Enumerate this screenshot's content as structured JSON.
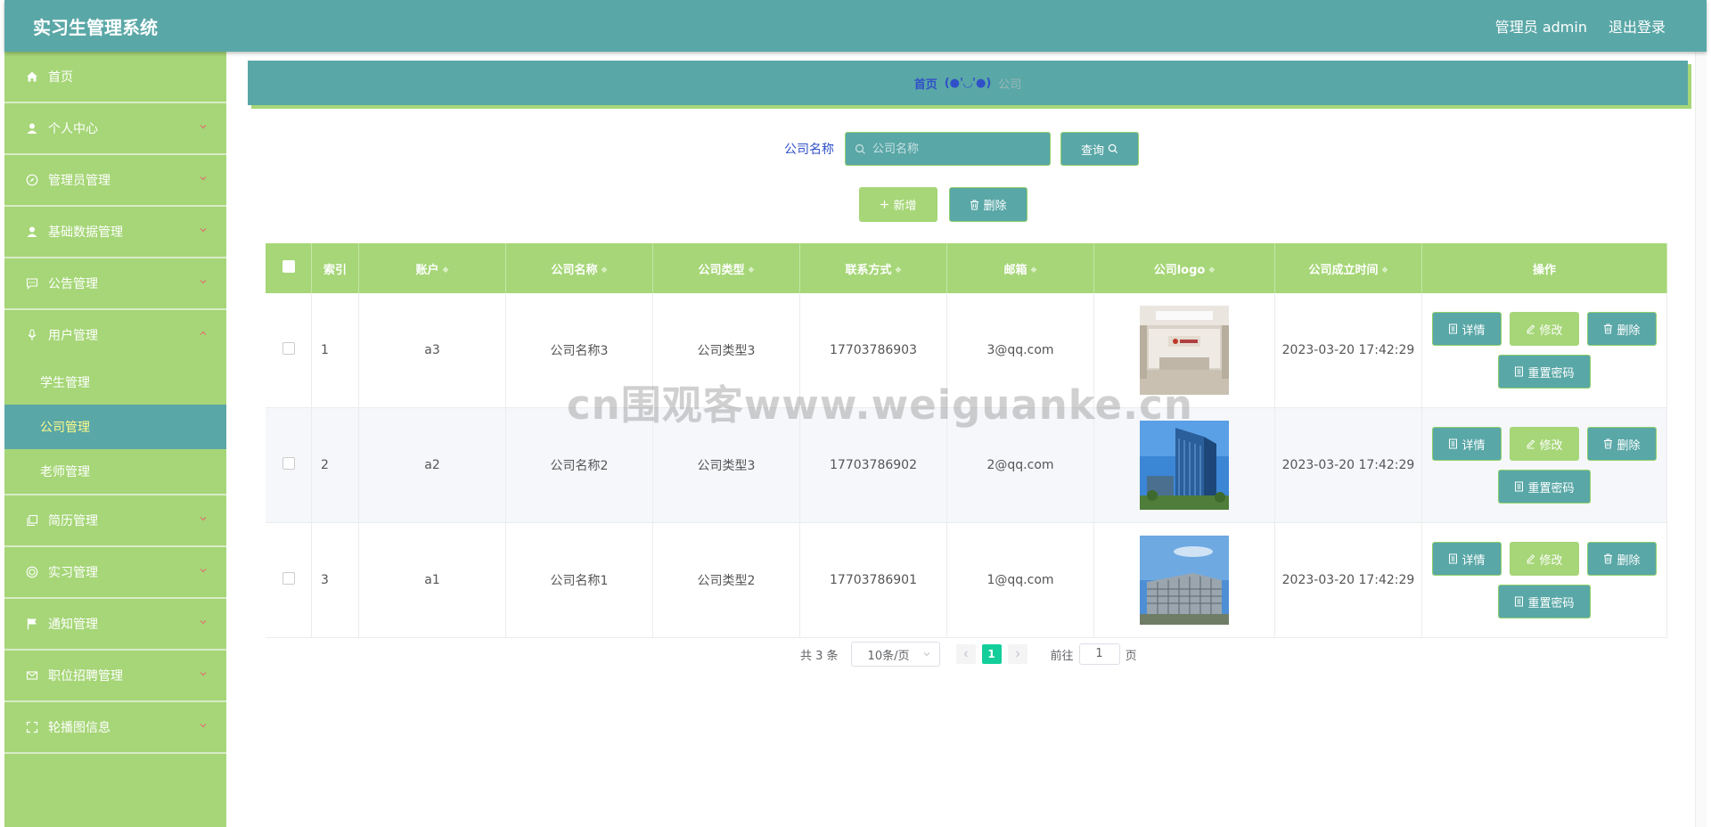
{
  "header": {
    "title": "实习生管理系统",
    "user": "管理员 admin",
    "logout": "退出登录"
  },
  "sidebar": {
    "items": [
      {
        "label": "首页",
        "icon": "home-icon"
      },
      {
        "label": "个人中心",
        "icon": "user-icon"
      },
      {
        "label": "管理员管理",
        "icon": "compass-icon"
      },
      {
        "label": "基础数据管理",
        "icon": "user-icon"
      },
      {
        "label": "公告管理",
        "icon": "chat-icon"
      },
      {
        "label": "用户管理",
        "icon": "mic-icon",
        "children": [
          "学生管理",
          "公司管理",
          "老师管理"
        ]
      },
      {
        "label": "简历管理",
        "icon": "copy-icon"
      },
      {
        "label": "实习管理",
        "icon": "target-icon"
      },
      {
        "label": "通知管理",
        "icon": "flag-icon"
      },
      {
        "label": "职位招聘管理",
        "icon": "mail-icon"
      },
      {
        "label": "轮播图信息",
        "icon": "fullscreen-icon"
      }
    ]
  },
  "breadcrumb": {
    "home": "首页",
    "emoticon": "(●'◡'●)",
    "current": "公司"
  },
  "search": {
    "label": "公司名称",
    "placeholder": "公司名称",
    "query_button": "查询"
  },
  "actions": {
    "add": "新增",
    "delete": "删除"
  },
  "table": {
    "headers": [
      "索引",
      "账户",
      "公司名称",
      "公司类型",
      "联系方式",
      "邮箱",
      "公司logo",
      "公司成立时间",
      "操作"
    ],
    "rows": [
      {
        "index": "1",
        "account": "a3",
        "name": "公司名称3",
        "type": "公司类型3",
        "phone": "17703786903",
        "email": "3@qq.com",
        "logo": "office-interior",
        "founded": "2023-03-20 17:42:29"
      },
      {
        "index": "2",
        "account": "a2",
        "name": "公司名称2",
        "type": "公司类型3",
        "phone": "17703786902",
        "email": "2@qq.com",
        "logo": "glass-tower",
        "founded": "2023-03-20 17:42:29"
      },
      {
        "index": "3",
        "account": "a1",
        "name": "公司名称1",
        "type": "公司类型2",
        "phone": "17703786901",
        "email": "1@qq.com",
        "logo": "campus-building",
        "founded": "2023-03-20 17:42:29"
      }
    ],
    "row_actions": {
      "detail": "详情",
      "edit": "修改",
      "delete": "删除",
      "reset": "重置密码"
    }
  },
  "pagination": {
    "total": "共 3 条",
    "page_size": "10条/页",
    "current_page": "1",
    "goto_label": "前往",
    "goto_value": "1",
    "page_suffix": "页"
  },
  "watermark": "cn围观客www.weiguanke.cn",
  "colors": {
    "header": "#5aa7a7",
    "sidebar": "#a6d677",
    "active": "#5aa7a7",
    "page_active": "#13ce9a"
  }
}
